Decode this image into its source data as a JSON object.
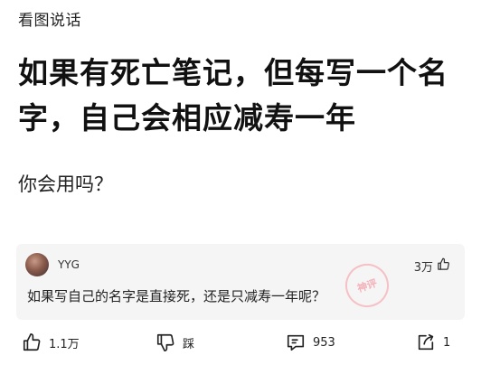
{
  "header": {
    "category": "看图说话"
  },
  "post": {
    "title": "如果有死亡笔记，但每写一个名字，自己会相应减寿一年",
    "body": "你会用吗？"
  },
  "top_comment": {
    "author": "YYG",
    "likes": "3万",
    "text": "如果写自己的名字是直接死，还是只减寿一年呢？",
    "stamp_text": "神评"
  },
  "actions": {
    "like_count": "1.1万",
    "dislike_label": "踩",
    "comment_count": "953",
    "share_count": "1"
  },
  "colors": {
    "card_background": "#f5f5f5",
    "stamp_pink": "#f3a5ae"
  }
}
